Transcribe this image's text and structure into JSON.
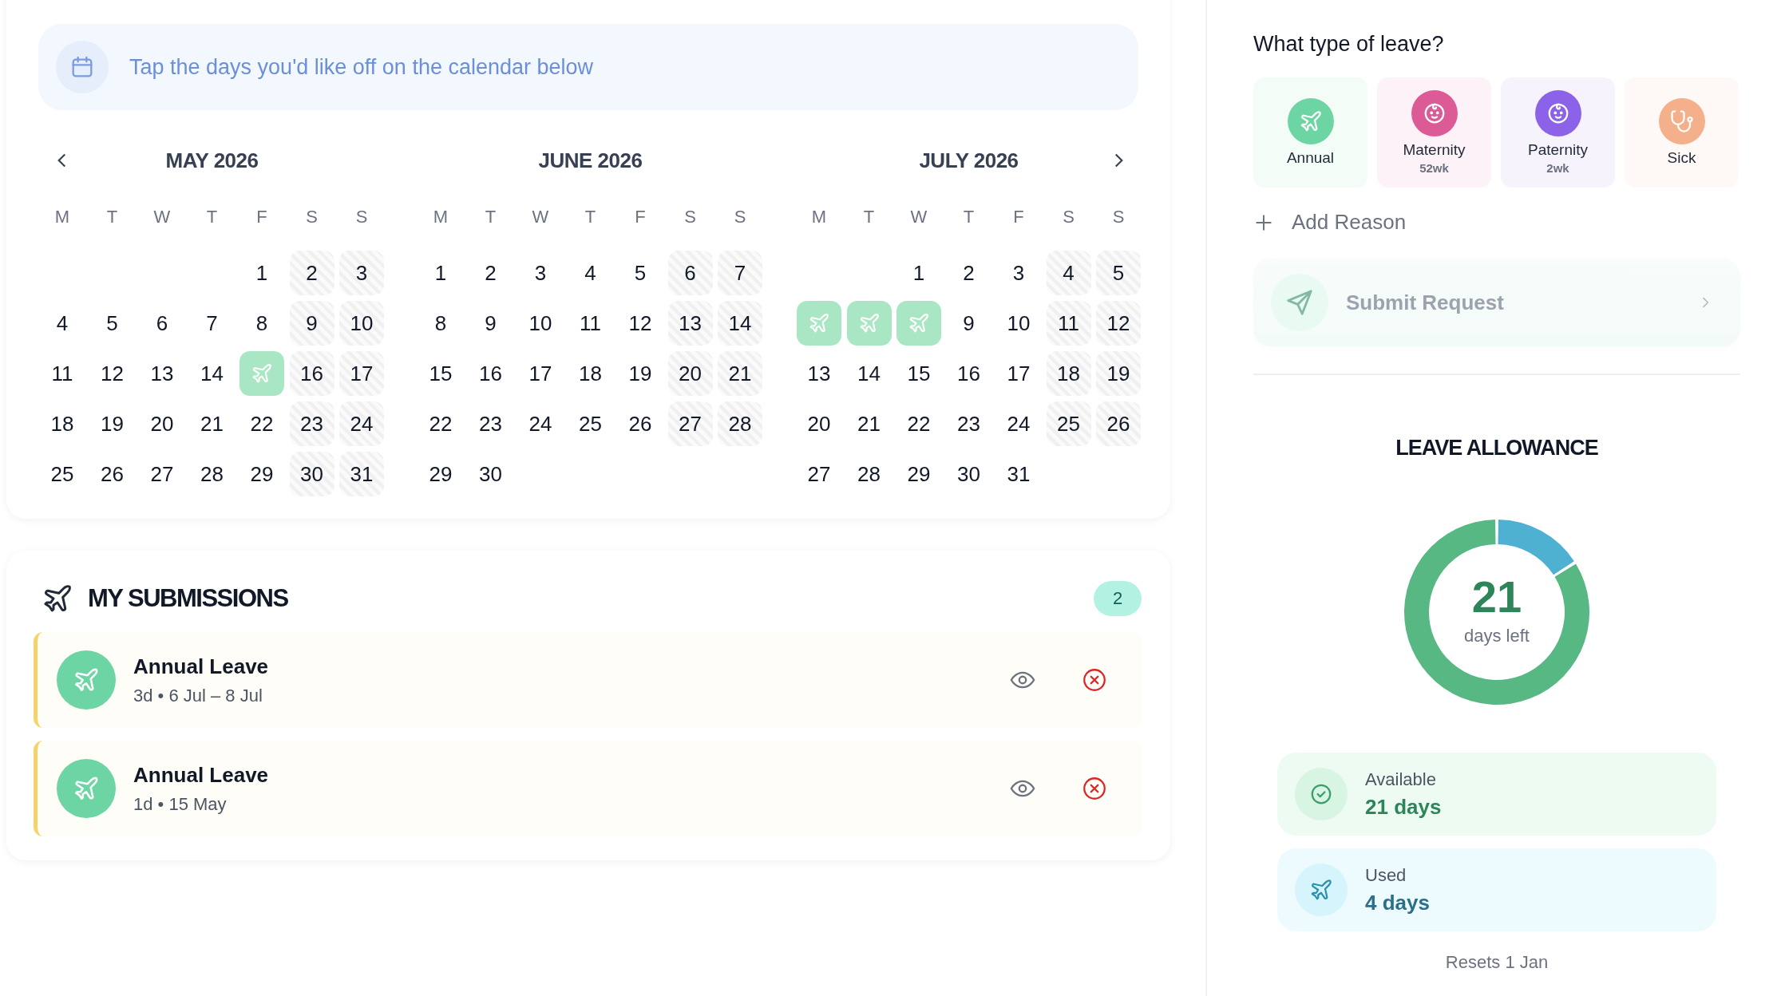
{
  "banner": {
    "text": "Tap the days you'd like off on the calendar below"
  },
  "calendar": {
    "months": [
      {
        "title": "MAY 2026",
        "nav_prev": true,
        "nav_next": false,
        "weekdays": [
          "M",
          "T",
          "W",
          "T",
          "F",
          "S",
          "S"
        ],
        "weeks": [
          [
            {
              "day": "1",
              "kind": "weekday"
            },
            {
              "day": "2",
              "kind": "weekend"
            },
            {
              "day": "3",
              "kind": "weekend"
            }
          ],
          [
            {
              "day": "4",
              "kind": "weekday"
            },
            {
              "day": "5",
              "kind": "weekday"
            },
            {
              "day": "6",
              "kind": "weekday"
            },
            {
              "day": "7",
              "kind": "weekday"
            },
            {
              "day": "8",
              "kind": "weekday"
            },
            {
              "day": "9",
              "kind": "weekend"
            },
            {
              "day": "10",
              "kind": "weekend"
            }
          ],
          [
            {
              "day": "11",
              "kind": "weekday"
            },
            {
              "day": "12",
              "kind": "weekday"
            },
            {
              "day": "13",
              "kind": "weekday"
            },
            {
              "day": "14",
              "kind": "weekday"
            },
            {
              "kind": "booked"
            },
            {
              "day": "16",
              "kind": "weekend"
            },
            {
              "day": "17",
              "kind": "weekend"
            }
          ],
          [
            {
              "day": "18",
              "kind": "weekday"
            },
            {
              "day": "19",
              "kind": "weekday"
            },
            {
              "day": "20",
              "kind": "weekday"
            },
            {
              "day": "21",
              "kind": "weekday"
            },
            {
              "day": "22",
              "kind": "weekday"
            },
            {
              "day": "23",
              "kind": "weekend"
            },
            {
              "day": "24",
              "kind": "weekend"
            }
          ],
          [
            {
              "day": "25",
              "kind": "weekday"
            },
            {
              "day": "26",
              "kind": "weekday"
            },
            {
              "day": "27",
              "kind": "weekday"
            },
            {
              "day": "28",
              "kind": "weekday"
            },
            {
              "day": "29",
              "kind": "weekday"
            },
            {
              "day": "30",
              "kind": "weekend"
            },
            {
              "day": "31",
              "kind": "weekend"
            }
          ]
        ]
      },
      {
        "title": "JUNE 2026",
        "nav_prev": false,
        "nav_next": false,
        "weekdays": [
          "M",
          "T",
          "W",
          "T",
          "F",
          "S",
          "S"
        ],
        "weeks": [
          [
            {
              "day": "1",
              "kind": "weekday"
            },
            {
              "day": "2",
              "kind": "weekday"
            },
            {
              "day": "3",
              "kind": "weekday"
            },
            {
              "day": "4",
              "kind": "weekday"
            },
            {
              "day": "5",
              "kind": "weekday"
            },
            {
              "day": "6",
              "kind": "weekend"
            },
            {
              "day": "7",
              "kind": "weekend"
            }
          ],
          [
            {
              "day": "8",
              "kind": "weekday"
            },
            {
              "day": "9",
              "kind": "weekday"
            },
            {
              "day": "10",
              "kind": "weekday"
            },
            {
              "day": "11",
              "kind": "weekday"
            },
            {
              "day": "12",
              "kind": "weekday"
            },
            {
              "day": "13",
              "kind": "weekend"
            },
            {
              "day": "14",
              "kind": "weekend"
            }
          ],
          [
            {
              "day": "15",
              "kind": "weekday"
            },
            {
              "day": "16",
              "kind": "weekday"
            },
            {
              "day": "17",
              "kind": "weekday"
            },
            {
              "day": "18",
              "kind": "weekday"
            },
            {
              "day": "19",
              "kind": "weekday"
            },
            {
              "day": "20",
              "kind": "weekend"
            },
            {
              "day": "21",
              "kind": "weekend"
            }
          ],
          [
            {
              "day": "22",
              "kind": "weekday"
            },
            {
              "day": "23",
              "kind": "weekday"
            },
            {
              "day": "24",
              "kind": "weekday"
            },
            {
              "day": "25",
              "kind": "weekday"
            },
            {
              "day": "26",
              "kind": "weekday"
            },
            {
              "day": "27",
              "kind": "weekend"
            },
            {
              "day": "28",
              "kind": "weekend"
            }
          ],
          [
            {
              "day": "29",
              "kind": "weekday"
            },
            {
              "day": "30",
              "kind": "weekday"
            }
          ]
        ]
      },
      {
        "title": "JULY 2026",
        "nav_prev": false,
        "nav_next": true,
        "weekdays": [
          "M",
          "T",
          "W",
          "T",
          "F",
          "S",
          "S"
        ],
        "weeks": [
          [
            {
              "day": "1",
              "kind": "weekday"
            },
            {
              "day": "2",
              "kind": "weekday"
            },
            {
              "day": "3",
              "kind": "weekday"
            },
            {
              "day": "4",
              "kind": "weekend"
            },
            {
              "day": "5",
              "kind": "weekend"
            }
          ],
          [
            {
              "kind": "booked"
            },
            {
              "kind": "booked"
            },
            {
              "kind": "booked"
            },
            {
              "day": "9",
              "kind": "weekday"
            },
            {
              "day": "10",
              "kind": "weekday"
            },
            {
              "day": "11",
              "kind": "weekend"
            },
            {
              "day": "12",
              "kind": "weekend"
            }
          ],
          [
            {
              "day": "13",
              "kind": "weekday"
            },
            {
              "day": "14",
              "kind": "weekday"
            },
            {
              "day": "15",
              "kind": "weekday"
            },
            {
              "day": "16",
              "kind": "weekday"
            },
            {
              "day": "17",
              "kind": "weekday"
            },
            {
              "day": "18",
              "kind": "weekend"
            },
            {
              "day": "19",
              "kind": "weekend"
            }
          ],
          [
            {
              "day": "20",
              "kind": "weekday"
            },
            {
              "day": "21",
              "kind": "weekday"
            },
            {
              "day": "22",
              "kind": "weekday"
            },
            {
              "day": "23",
              "kind": "weekday"
            },
            {
              "day": "24",
              "kind": "weekday"
            },
            {
              "day": "25",
              "kind": "weekend"
            },
            {
              "day": "26",
              "kind": "weekend"
            }
          ],
          [
            {
              "day": "27",
              "kind": "weekday"
            },
            {
              "day": "28",
              "kind": "weekday"
            },
            {
              "day": "29",
              "kind": "weekday"
            },
            {
              "day": "30",
              "kind": "weekday"
            },
            {
              "day": "31",
              "kind": "weekday"
            }
          ]
        ]
      }
    ]
  },
  "submissions": {
    "title": "MY SUBMISSIONS",
    "count": "2",
    "items": [
      {
        "title": "Annual Leave",
        "detail": "3d • 6 Jul – 8 Jul"
      },
      {
        "title": "Annual Leave",
        "detail": "1d • 15 May"
      }
    ]
  },
  "leave_types": {
    "title": "What type of leave?",
    "items": [
      {
        "label": "Annual",
        "kind": "plane",
        "color": "#6dd5a4"
      },
      {
        "label": "Maternity",
        "sub": "52wk",
        "kind": "baby",
        "color": "#dc5a96"
      },
      {
        "label": "Paternity",
        "sub": "2wk",
        "kind": "baby",
        "color": "#8b62e8"
      },
      {
        "label": "Sick",
        "kind": "stethoscope",
        "color": "#f3b08b"
      }
    ]
  },
  "add_reason": "Add Reason",
  "submit": "Submit Request",
  "allowance": {
    "title": "LEAVE ALLOWANCE",
    "big": "21",
    "caption": "days left",
    "chart_data": {
      "type": "donut",
      "values": [
        84,
        16
      ]
    },
    "stats": [
      {
        "kind": "available",
        "label": "Available",
        "value": "21 days"
      },
      {
        "kind": "used",
        "label": "Used",
        "value": "4 days"
      }
    ],
    "reset": "Resets 1 Jan"
  }
}
